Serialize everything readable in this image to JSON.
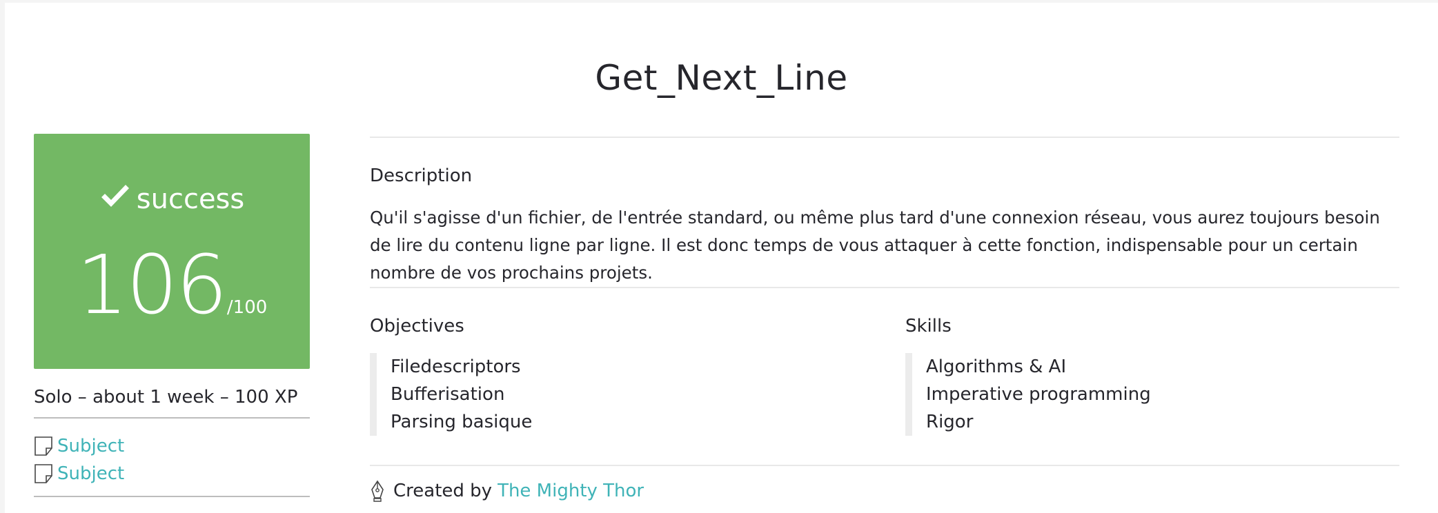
{
  "project": {
    "title": "Get_Next_Line"
  },
  "result": {
    "status": "success",
    "score": "106",
    "max_score": "/100",
    "status_color": "#73b864"
  },
  "sidebar": {
    "meta": "Solo – about 1 week – 100 XP",
    "links": [
      {
        "label": "Subject",
        "icon": "document-icon"
      },
      {
        "label": "Subject",
        "icon": "document-icon"
      }
    ]
  },
  "description": {
    "heading": "Description",
    "text": "Qu'il s'agisse d'un fichier, de l'entrée standard, ou même plus tard d'une connexion réseau, vous aurez toujours besoin de lire du contenu ligne par ligne. Il est donc temps de vous attaquer à cette fonction, indispensable pour un certain nombre de vos prochains projets."
  },
  "objectives": {
    "heading": "Objectives",
    "items": [
      "Filedescriptors",
      "Bufferisation",
      "Parsing basique"
    ]
  },
  "skills": {
    "heading": "Skills",
    "items": [
      "Algorithms & AI",
      "Imperative programming",
      "Rigor"
    ]
  },
  "credit": {
    "prefix": "Created by",
    "author": "The Mighty Thor",
    "icon": "pen-nib-icon"
  },
  "colors": {
    "accent_link": "#3fb3b7",
    "success": "#73b864"
  }
}
